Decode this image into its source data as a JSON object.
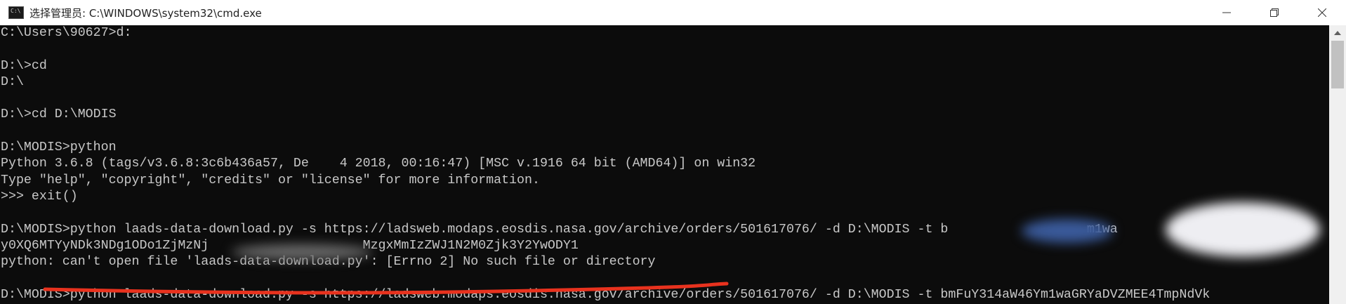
{
  "window": {
    "title": "选择管理员: C:\\WINDOWS\\system32\\cmd.exe",
    "icon": "cmd-app-icon",
    "controls": [
      "minimize-icon",
      "restore-icon",
      "close-icon"
    ]
  },
  "console": {
    "lines": [
      "C:\\Users\\90627>d:",
      "",
      "D:\\>cd",
      "D:\\",
      "",
      "D:\\>cd D:\\MODIS",
      "",
      "D:\\MODIS>python",
      "Python 3.6.8 (tags/v3.6.8:3c6b436a57, De    4 2018, 00:16:47) [MSC v.1916 64 bit (AMD64)] on win32",
      "Type \"help\", \"copyright\", \"credits\" or \"license\" for more information.",
      ">>> exit()",
      "",
      "D:\\MODIS>python laads-data-download.py -s https://ladsweb.modaps.eosdis.nasa.gov/archive/orders/501617076/ -d D:\\MODIS -t b                  m1wa                  mpNdVk",
      "y0XQ6MTYyNDk3NDg1ODo1ZjMzNj                    MzgxMmIzZWJ1N2M0Zjk3Y2YwODY1",
      "python: can't open file 'laads-data-download.py': [Errno 2] No such file or directory",
      "",
      "D:\\MODIS>python laads-data-download.py -s https://ladsweb.modaps.eosdis.nasa.gov/archive/orders/501617076/ -d D:\\MODIS -t bmFuY314aW46Ym1waGRYaDVZMEE4TmpNdVk"
    ]
  },
  "colors": {
    "console_bg": "#0c0c0c",
    "console_text": "#c8c8c8",
    "annotation": "#e8321e"
  }
}
